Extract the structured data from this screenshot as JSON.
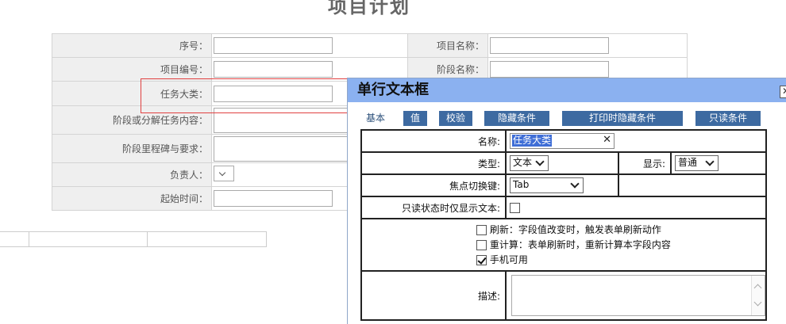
{
  "page": {
    "title": "项目计划"
  },
  "form": {
    "rows": [
      {
        "label": "序号：",
        "right_label": "项目名称："
      },
      {
        "label": "项目编号：",
        "right_label": "阶段名称："
      },
      {
        "label": "任务大类："
      },
      {
        "label": "阶段或分解任务内容："
      },
      {
        "label": "阶段里程碑与要求："
      },
      {
        "label": "负责人："
      },
      {
        "label": "起始时间："
      }
    ]
  },
  "dialog": {
    "title": "单行文本框",
    "close_icon": "✕",
    "tabs": [
      "基本",
      "值",
      "校验",
      "隐藏条件",
      "打印时隐藏条件",
      "只读条件"
    ],
    "fields": {
      "name_label": "名称:",
      "name_value": "任务大类",
      "clear_icon": "✕",
      "type_label": "类型:",
      "type_value": "文本",
      "display_label": "显示:",
      "display_value": "普通",
      "focus_label": "焦点切换键:",
      "focus_value": "Tab",
      "readonly_label": "只读状态时仅显示文本:",
      "refresh_label": "刷新：字段值改变时，触发表单刷新动作",
      "recalc_label": "重计算：表单刷新时，重新计算本字段内容",
      "mobile_label": "手机可用",
      "desc_label": "描述:"
    }
  }
}
